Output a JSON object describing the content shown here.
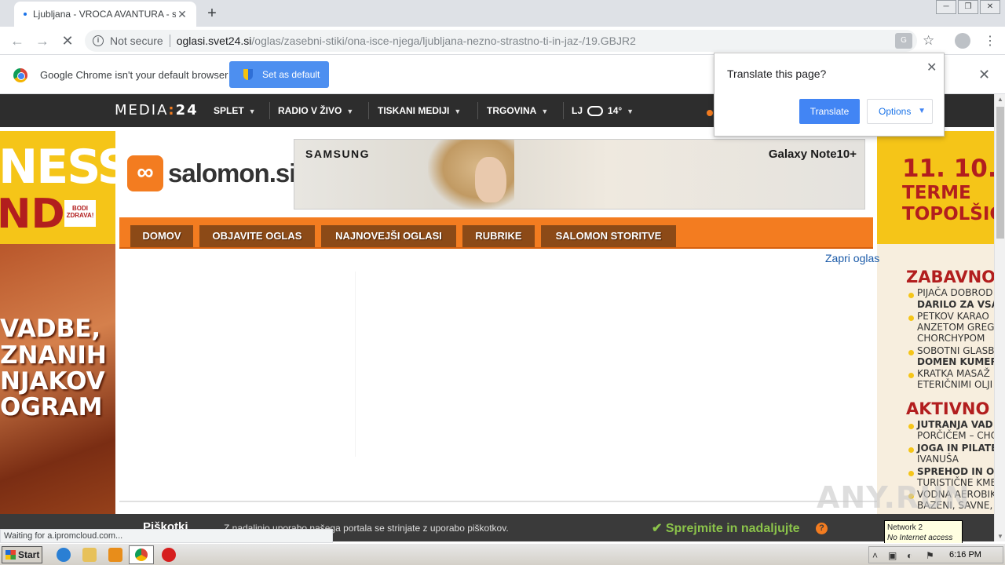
{
  "browser": {
    "tab_title": "Ljubljana - VROCA AVANTURA - salomon.si",
    "new_tab": "+",
    "window_controls": [
      "─",
      "❐",
      "✕"
    ],
    "not_secure": "Not secure",
    "url_host": "oglasi.svet24.si",
    "url_path": "/oglas/zasebni-stiki/ona-isce-njega/ljubljana-nezno-strastno-ti-in-jaz-/19.GBJR2",
    "status_text": "Waiting for a.ipromcloud.com..."
  },
  "infobar": {
    "message": "Google Chrome isn't your default browser",
    "button": "Set as default"
  },
  "translate_popup": {
    "title": "Translate this page?",
    "translate_button": "Translate",
    "options_button": "Options"
  },
  "site_nav": {
    "logo_text": "MEDIA",
    "logo_colon": ":",
    "logo_num": "24",
    "items": [
      {
        "label": "SPLET"
      },
      {
        "label": "RADIO V ŽIVO"
      },
      {
        "label": "TISKANI MEDIJI"
      },
      {
        "label": "TRGOVINA"
      }
    ],
    "weather_city": "LJ",
    "weather_temp": "14°"
  },
  "left_ad": {
    "ness": "NESS",
    "nd": "ND",
    "bodi": "BODI ZDRAVA!",
    "lines": [
      "VADBE,",
      "ZNANIH",
      "NJAKOV",
      "OGRAM"
    ]
  },
  "right_ad": {
    "date": "11. 10. -",
    "terme": [
      "TERME",
      "TOPOLŠIC"
    ],
    "section1": "ZABAVNO",
    "items1": [
      [
        "PIJAČA DOBROD",
        "DARILO ZA VSAK"
      ],
      [
        "PETKOV KARAO",
        "ANZETOM GREG",
        "CHORCHYPOM"
      ],
      [
        "SOBOTNI GLASB",
        "DOMEN KUMER"
      ],
      [
        "KRATKA MASAŽ",
        "ETERIČNIMI OLJI"
      ]
    ],
    "section2": "AKTIVNO",
    "items2": [
      [
        "JUTRANJA VAD",
        "PORČIČEM – CHO"
      ],
      [
        "JOGA IN PILATE",
        "IVANUŠA"
      ],
      [
        "SPREHOD IN OG",
        "TURISTIČNE KME"
      ],
      [
        "VODNA AEROBIK",
        "BAZENI, SAVNE,"
      ]
    ]
  },
  "salomon": {
    "logo_mark": "∞",
    "logo_name": "salomon.si",
    "ad_brand": "SAMSUNG",
    "ad_product": "Galaxy Note10+",
    "menu": [
      {
        "label": "DOMOV"
      },
      {
        "label": "OBJAVITE OGLAS"
      },
      {
        "label": "NAJNOVEJŠI OGLASI"
      },
      {
        "label": "RUBRIKE"
      },
      {
        "label": "SALOMON STORITVE"
      }
    ],
    "close_ad": "Zapri oglas"
  },
  "cookie_bar": {
    "title": "Piškotki",
    "text": "Z nadaljnjo uporabo našega portala se strinjate z uporabo piškotkov.",
    "accept": "Sprejmite in nadaljujte",
    "help": "?"
  },
  "watermark": "ANY.RUN",
  "network_tooltip": {
    "line1": "Network  2",
    "line2": "No Internet access"
  },
  "taskbar": {
    "start": "Start",
    "clock": "6:16 PM"
  },
  "colors": {
    "accent_orange": "#f37c20",
    "nav_dark": "#2d2d2d",
    "chrome_blue": "#4285f4",
    "ad_red": "#b21e1e",
    "cookie_green": "#8bc34a"
  }
}
